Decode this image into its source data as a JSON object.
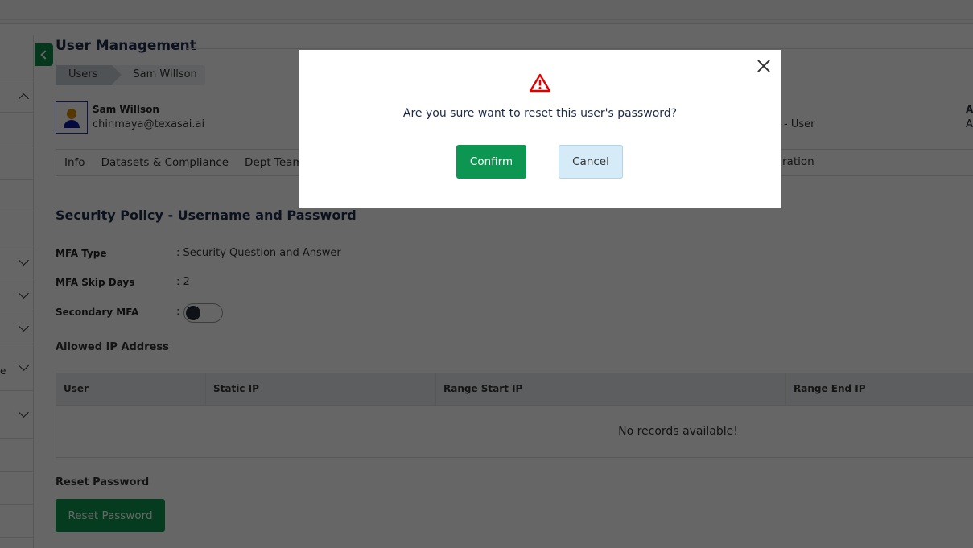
{
  "header": {
    "title": "User Management"
  },
  "breadcrumb": [
    "Users",
    "Sam Willson"
  ],
  "user": {
    "name": "Sam Willson",
    "email": "chinmaya@texasai.ai",
    "role_fragment": "- User",
    "extra_label_fragment": "A",
    "extra_value_fragment": "A"
  },
  "tabs": [
    "Info",
    "Datasets & Compliance",
    "Dept Team"
  ],
  "tab_fragment": "ration",
  "sidebar": {
    "label_fragment": "e"
  },
  "security": {
    "title": "Security Policy - Username and Password",
    "fields": [
      {
        "label": "MFA Type",
        "value": ": Security Question and Answer"
      },
      {
        "label": "MFA Skip Days",
        "value": ": 2"
      },
      {
        "label": "Secondary MFA",
        "value": ":"
      }
    ],
    "secondary_mfa_enabled": false
  },
  "ip": {
    "title": "Allowed IP Address",
    "columns": [
      "User",
      "Static IP",
      "Range Start IP",
      "Range End IP"
    ],
    "empty_text": "No records available!"
  },
  "reset": {
    "title": "Reset Password",
    "button": "Reset Password"
  },
  "modal": {
    "icon": "warning-icon",
    "message": "Are you sure want to reset this user's password?",
    "confirm": "Confirm",
    "cancel": "Cancel"
  },
  "colors": {
    "primary": "#0d9651",
    "warning": "#e00000",
    "heading": "#1e2a4a",
    "cancel_bg": "#d5ecf8"
  }
}
